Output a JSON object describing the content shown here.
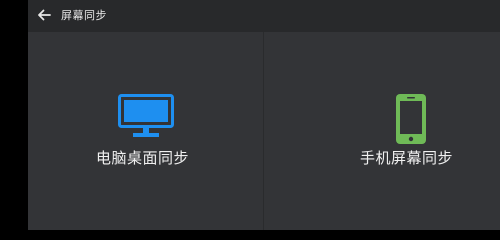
{
  "header": {
    "title": "屏幕同步",
    "back_icon": "arrow-left-icon"
  },
  "options": [
    {
      "label": "电脑桌面同步",
      "icon": "monitor-icon",
      "color": "#1e8ff0"
    },
    {
      "label": "手机屏幕同步",
      "icon": "smartphone-icon",
      "color": "#6fba57"
    }
  ],
  "colors": {
    "background": "#333437",
    "header_background": "#28292b",
    "text": "#f0f0f0"
  }
}
